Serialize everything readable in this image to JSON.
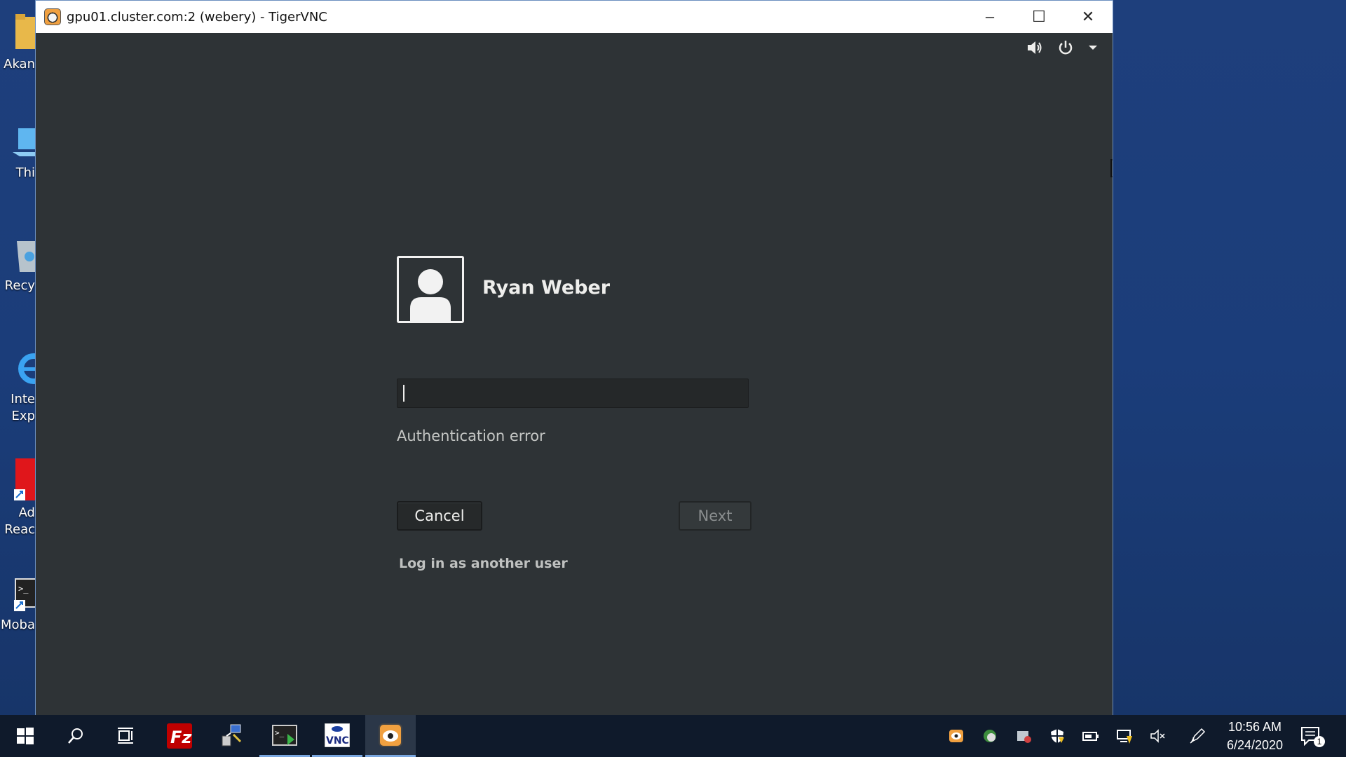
{
  "window": {
    "title": "gpu01.cluster.com:2 (webery) - TigerVNC",
    "minimize_label": "–",
    "maximize_label": "☐",
    "close_label": "✕"
  },
  "desktop_icons": [
    {
      "label": "Akan",
      "icon": "folder-icon"
    },
    {
      "label": "Thi",
      "icon": "this-pc-icon"
    },
    {
      "label": "Recy",
      "icon": "recycle-bin-icon"
    },
    {
      "label": "Inte\nExp",
      "icon": "internet-explorer-icon"
    },
    {
      "label": "Ad\nReac",
      "icon": "adobe-reader-icon"
    },
    {
      "label": "Moba",
      "icon": "mobaxterm-icon"
    }
  ],
  "login": {
    "user_name": "Ryan Weber",
    "password_value": "",
    "error_text": "Authentication error",
    "cancel_label": "Cancel",
    "next_label": "Next",
    "other_user_label": "Log in as another user"
  },
  "taskbar": {
    "clock_time": "10:56 AM",
    "clock_date": "6/24/2020",
    "notification_count": "1",
    "apps": [
      "start-icon",
      "search-icon",
      "task-view-icon",
      "filezilla-icon",
      "network-tool-icon",
      "mobaxterm-icon",
      "vnc-viewer-icon",
      "tigervnc-icon"
    ]
  },
  "colors": {
    "desktop_bg": "#1b3d7a",
    "gnome_bg": "#2e3336",
    "taskbar_bg": "#0f1a2b",
    "text_light": "#eeeeec"
  }
}
